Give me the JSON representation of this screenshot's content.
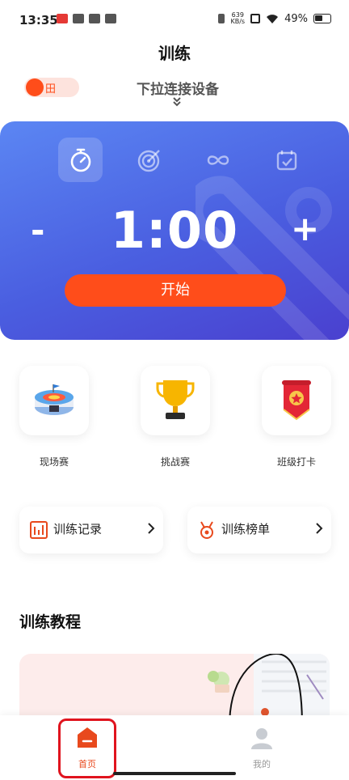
{
  "status_bar": {
    "time": "13:35",
    "net_speed_value": "639",
    "net_speed_unit": "KB/s",
    "battery": "49%"
  },
  "header": {
    "title": "训练",
    "toggle_label": "田",
    "pull_hint": "下拉连接设备"
  },
  "timer_card": {
    "modes": [
      {
        "icon": "stopwatch-icon",
        "active": true
      },
      {
        "icon": "target-icon",
        "active": false
      },
      {
        "icon": "infinity-icon",
        "active": false
      },
      {
        "icon": "calendar-check-icon",
        "active": false
      }
    ],
    "minus_label": "-",
    "plus_label": "+",
    "time": "1:00",
    "start_label": "开始",
    "accent": "#ff4d1a",
    "gradient": [
      "#5b86f3",
      "#4a40cf"
    ]
  },
  "features": [
    {
      "label": "现场赛",
      "icon": "stadium-icon"
    },
    {
      "label": "挑战赛",
      "icon": "trophy-icon"
    },
    {
      "label": "班级打卡",
      "icon": "pennant-badge-icon"
    }
  ],
  "entries": [
    {
      "label": "训练记录",
      "icon": "bar-chart-icon"
    },
    {
      "label": "训练榜单",
      "icon": "medal-icon"
    }
  ],
  "tutorials": {
    "title": "训练教程"
  },
  "bottom_nav": [
    {
      "label": "首页",
      "icon": "home-icon",
      "active": true
    },
    {
      "label": "我的",
      "icon": "user-icon",
      "active": false
    }
  ]
}
